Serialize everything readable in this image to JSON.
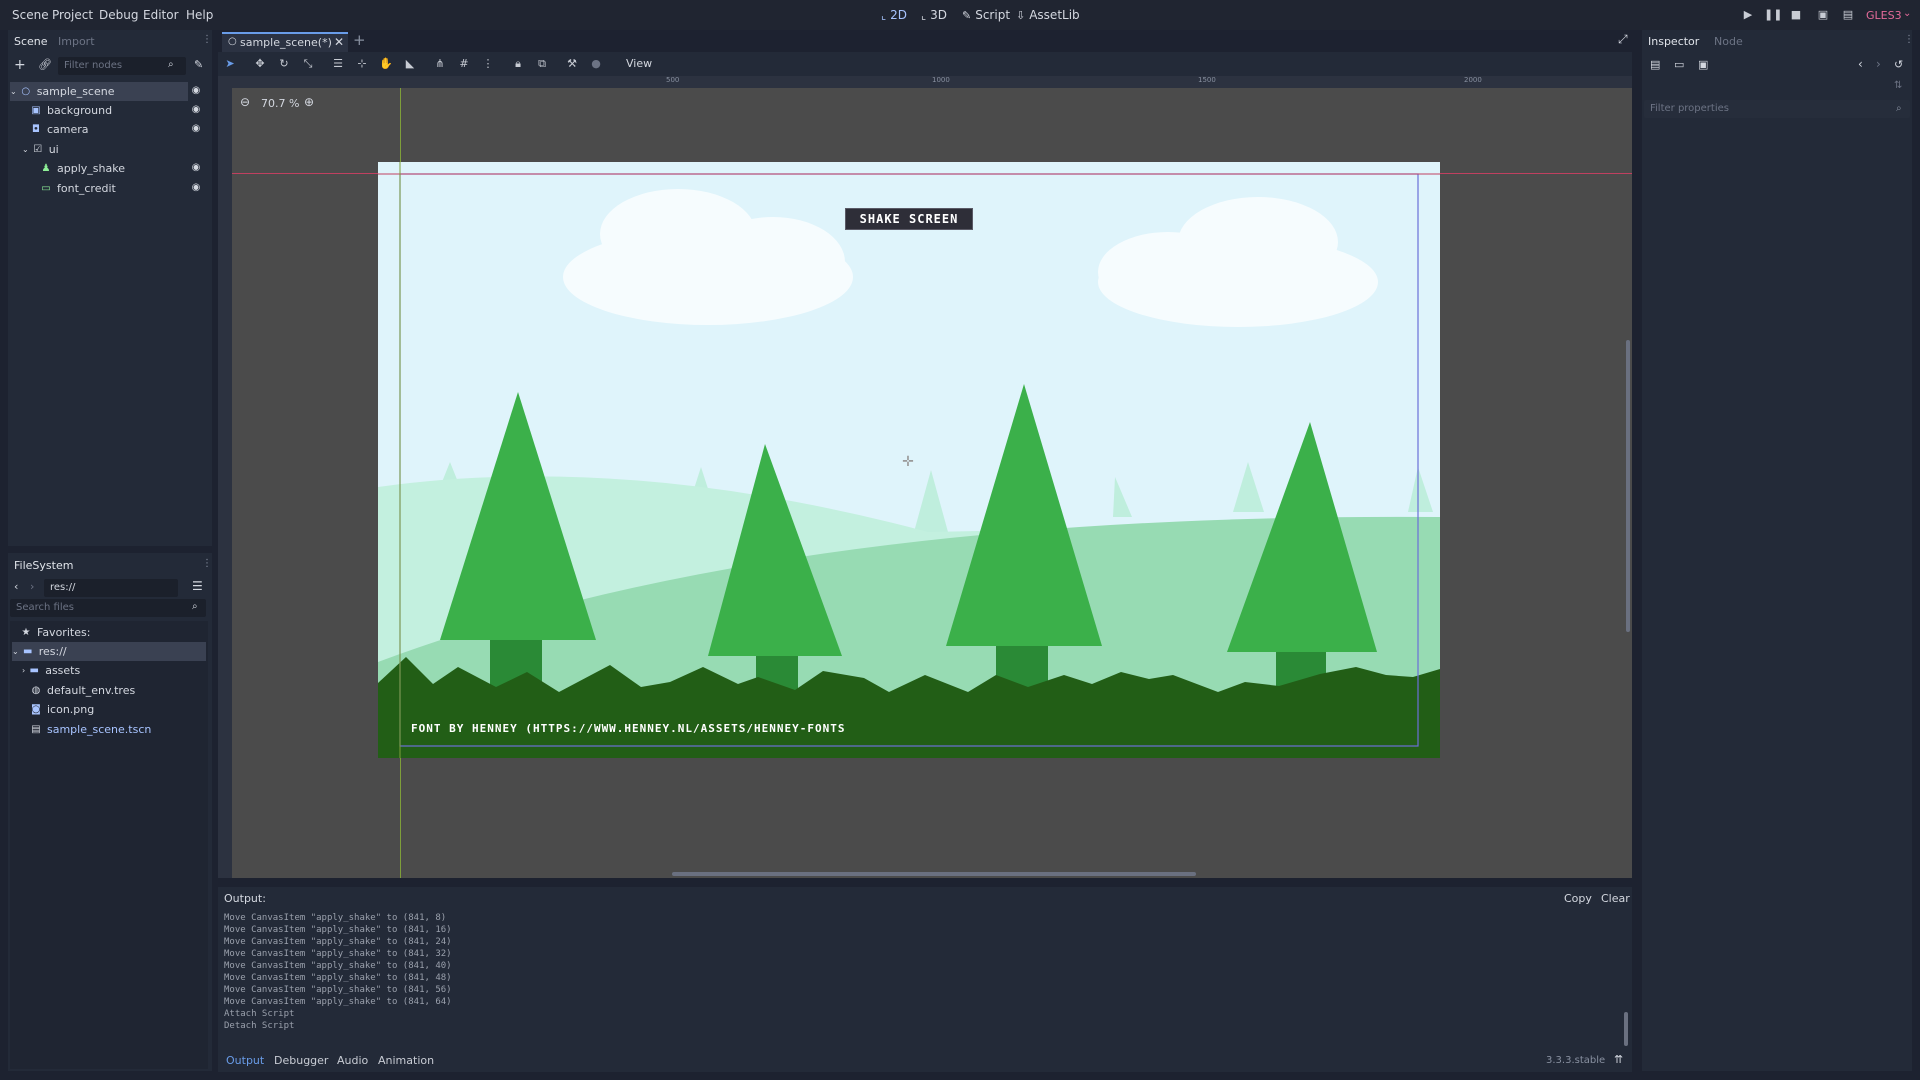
{
  "menu": {
    "items": [
      "Scene",
      "Project",
      "Debug",
      "Editor",
      "Help"
    ]
  },
  "workspaces": {
    "w2d": "2D",
    "w3d": "3D",
    "script": "Script",
    "assetlib": "AssetLib"
  },
  "renderer": "GLES3",
  "scene_dock": {
    "tabs": {
      "scene": "Scene",
      "import": "Import"
    },
    "filter_placeholder": "Filter nodes",
    "nodes": [
      {
        "label": "sample_scene",
        "icon": "node2d-icon"
      },
      {
        "label": "background",
        "icon": "sprite-icon"
      },
      {
        "label": "camera",
        "icon": "camera-icon"
      },
      {
        "label": "ui",
        "icon": "control-icon"
      },
      {
        "label": "apply_shake",
        "icon": "button-icon"
      },
      {
        "label": "font_credit",
        "icon": "label-icon"
      }
    ]
  },
  "filesystem": {
    "title": "FileSystem",
    "path": "res://",
    "search_placeholder": "Search files",
    "items": [
      {
        "label": "Favorites:",
        "icon": "star-icon"
      },
      {
        "label": "res://",
        "icon": "folder-icon"
      },
      {
        "label": "assets",
        "icon": "folder-icon"
      },
      {
        "label": "default_env.tres",
        "icon": "environment-icon"
      },
      {
        "label": "icon.png",
        "icon": "image-icon"
      },
      {
        "label": "sample_scene.tscn",
        "icon": "scene-icon"
      }
    ]
  },
  "editor_tab": {
    "label": "sample_scene(*)"
  },
  "toolbar": {
    "view_label": "View",
    "zoom": "70.7 %"
  },
  "rulers": {
    "labels": [
      "500",
      "1000",
      "1500",
      "2000"
    ]
  },
  "game": {
    "button_label": "SHAKE SCREEN",
    "credit": "FONT BY HENNEY (HTTPS://WWW.HENNEY.NL/ASSETS/HENNEY-FONTS"
  },
  "inspector": {
    "tabs": {
      "inspector": "Inspector",
      "node": "Node"
    },
    "filter_placeholder": "Filter properties"
  },
  "output": {
    "title": "Output:",
    "copy_label": "Copy",
    "clear_label": "Clear",
    "lines": [
      "Move CanvasItem \"apply_shake\" to (841, 8)",
      "Move CanvasItem \"apply_shake\" to (841, 16)",
      "Move CanvasItem \"apply_shake\" to (841, 24)",
      "Move CanvasItem \"apply_shake\" to (841, 32)",
      "Move CanvasItem \"apply_shake\" to (841, 40)",
      "Move CanvasItem \"apply_shake\" to (841, 48)",
      "Move CanvasItem \"apply_shake\" to (841, 56)",
      "Move CanvasItem \"apply_shake\" to (841, 64)",
      "Attach Script",
      "Detach Script"
    ]
  },
  "bottom_tabs": [
    "Output",
    "Debugger",
    "Audio",
    "Animation"
  ],
  "version": "3.3.3.stable",
  "colors": {
    "accent": "#699ce8",
    "renderer": "#e56b9a",
    "sky": "#dff4fb",
    "tree": "#3bb04a",
    "hill": "#97dbb3",
    "ground": "#225e16"
  }
}
